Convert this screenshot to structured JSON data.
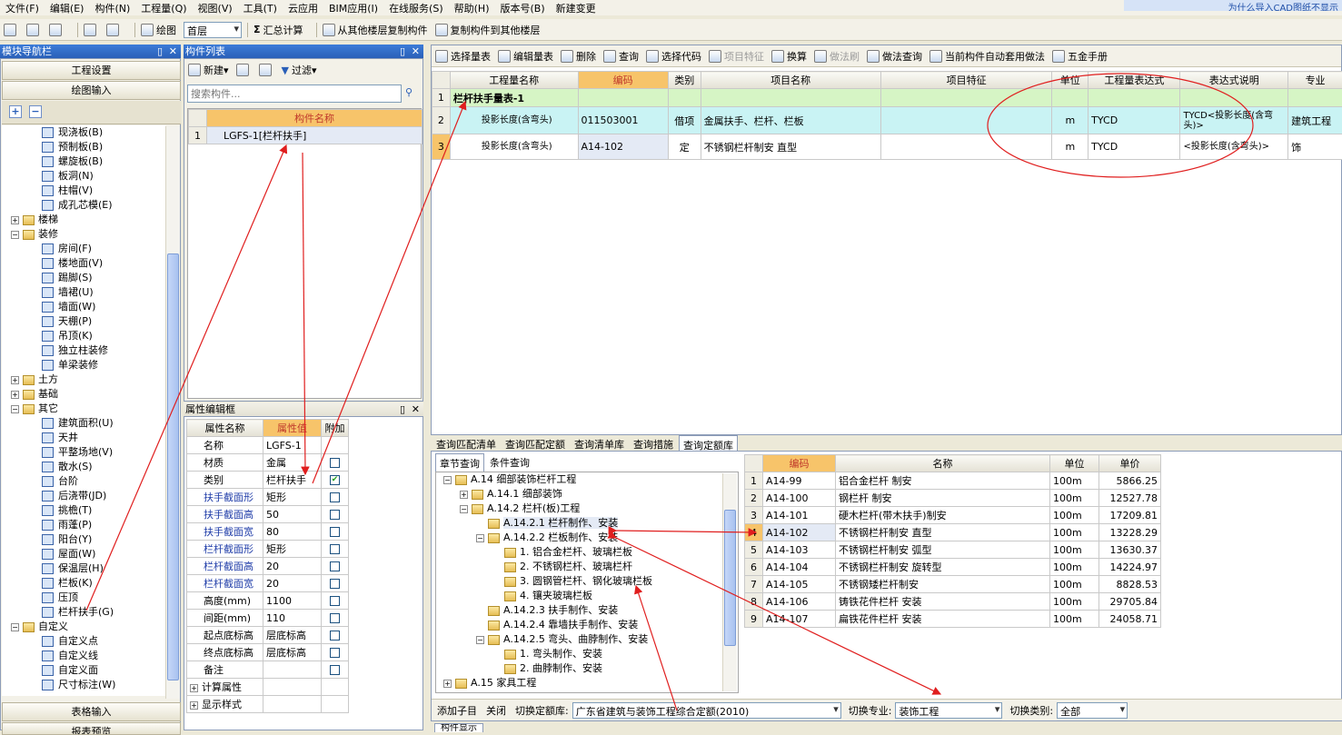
{
  "menu": [
    "文件(F)",
    "编辑(E)",
    "构件(N)",
    "工程量(Q)",
    "视图(V)",
    "工具(T)",
    "云应用",
    "BIM应用(I)",
    "在线服务(S)",
    "帮助(H)",
    "版本号(B)",
    "新建变更"
  ],
  "hint_text": "为什么导入CAD图纸不显示",
  "toolbar": {
    "draw": "绘图",
    "floor": "首层",
    "sum": "汇总计算",
    "copy_from": "从其他楼层复制构件",
    "copy_to": "复制构件到其他楼层"
  },
  "nav": {
    "title": "模块导航栏",
    "project_settings": "工程设置",
    "draw_input": "绘图输入",
    "table_input": "表格输入",
    "report": "报表预览"
  },
  "tree": [
    {
      "label": "现浇板(B)",
      "level": 2
    },
    {
      "label": "预制板(B)",
      "level": 2
    },
    {
      "label": "螺旋板(B)",
      "level": 2
    },
    {
      "label": "板洞(N)",
      "level": 2
    },
    {
      "label": "柱帽(V)",
      "level": 2
    },
    {
      "label": "成孔芯模(E)",
      "level": 2
    },
    {
      "label": "楼梯",
      "level": 0,
      "folder": true,
      "pm": "+"
    },
    {
      "label": "装修",
      "level": 0,
      "folder": true,
      "pm": "-"
    },
    {
      "label": "房间(F)",
      "level": 2
    },
    {
      "label": "楼地面(V)",
      "level": 2
    },
    {
      "label": "踢脚(S)",
      "level": 2
    },
    {
      "label": "墙裙(U)",
      "level": 2
    },
    {
      "label": "墙面(W)",
      "level": 2
    },
    {
      "label": "天棚(P)",
      "level": 2
    },
    {
      "label": "吊顶(K)",
      "level": 2
    },
    {
      "label": "独立柱装修",
      "level": 2
    },
    {
      "label": "单梁装修",
      "level": 2
    },
    {
      "label": "土方",
      "level": 0,
      "folder": true,
      "pm": "+"
    },
    {
      "label": "基础",
      "level": 0,
      "folder": true,
      "pm": "+"
    },
    {
      "label": "其它",
      "level": 0,
      "folder": true,
      "pm": "-"
    },
    {
      "label": "建筑面积(U)",
      "level": 2
    },
    {
      "label": "天井",
      "level": 2
    },
    {
      "label": "平整场地(V)",
      "level": 2
    },
    {
      "label": "散水(S)",
      "level": 2
    },
    {
      "label": "台阶",
      "level": 2
    },
    {
      "label": "后浇带(JD)",
      "level": 2
    },
    {
      "label": "挑檐(T)",
      "level": 2
    },
    {
      "label": "雨蓬(P)",
      "level": 2
    },
    {
      "label": "阳台(Y)",
      "level": 2
    },
    {
      "label": "屋面(W)",
      "level": 2
    },
    {
      "label": "保温层(H)",
      "level": 2
    },
    {
      "label": "栏板(K)",
      "level": 2
    },
    {
      "label": "压顶",
      "level": 2
    },
    {
      "label": "栏杆扶手(G)",
      "level": 2
    },
    {
      "label": "自定义",
      "level": 0,
      "folder": true,
      "pm": "-"
    },
    {
      "label": "自定义点",
      "level": 2
    },
    {
      "label": "自定义线",
      "level": 2
    },
    {
      "label": "自定义面",
      "level": 2
    },
    {
      "label": "尺寸标注(W)",
      "level": 2
    }
  ],
  "comp": {
    "title": "构件列表",
    "new": "新建",
    "filter": "过滤",
    "search_placeholder": "搜索构件...",
    "col": "构件名称",
    "rows": [
      {
        "n": "1",
        "name": "LGFS-1[栏杆扶手]"
      }
    ]
  },
  "prop": {
    "title": "属性编辑框",
    "cols": [
      "属性名称",
      "属性值",
      "附加"
    ],
    "rows": [
      {
        "name": "名称",
        "value": "LGFS-1",
        "chk": null,
        "blue": false
      },
      {
        "name": "材质",
        "value": "金属",
        "chk": false,
        "blue": false
      },
      {
        "name": "类别",
        "value": "栏杆扶手",
        "chk": true,
        "blue": false
      },
      {
        "name": "扶手截面形",
        "value": "矩形",
        "chk": false,
        "blue": true
      },
      {
        "name": "扶手截面高",
        "value": "50",
        "chk": false,
        "blue": true
      },
      {
        "name": "扶手截面宽",
        "value": "80",
        "chk": false,
        "blue": true
      },
      {
        "name": "栏杆截面形",
        "value": "矩形",
        "chk": false,
        "blue": true
      },
      {
        "name": "栏杆截面高",
        "value": "20",
        "chk": false,
        "blue": true
      },
      {
        "name": "栏杆截面宽",
        "value": "20",
        "chk": false,
        "blue": true
      },
      {
        "name": "高度(mm)",
        "value": "1100",
        "chk": false,
        "blue": false
      },
      {
        "name": "间距(mm)",
        "value": "110",
        "chk": false,
        "blue": false
      },
      {
        "name": "起点底标高",
        "value": "层底标高",
        "chk": false,
        "blue": false
      },
      {
        "name": "终点底标高",
        "value": "层底标高",
        "chk": false,
        "blue": false
      },
      {
        "name": "备注",
        "value": "",
        "chk": false,
        "blue": false
      },
      {
        "name": "计算属性",
        "value": "",
        "chk": null,
        "blue": false
      },
      {
        "name": "显示样式",
        "value": "",
        "chk": null,
        "blue": false
      }
    ]
  },
  "qtb": {
    "buttons": [
      "选择量表",
      "编辑量表",
      "删除",
      "查询",
      "选择代码",
      "项目特征",
      "换算",
      "做法刷",
      "做法查询",
      "当前构件自动套用做法",
      "五金手册"
    ],
    "cols": [
      "工程量名称",
      "编码",
      "类别",
      "项目名称",
      "项目特征",
      "单位",
      "工程量表达式",
      "表达式说明",
      "专业"
    ],
    "rows": [
      {
        "n": "1",
        "name": "栏杆扶手量表-1",
        "code": "",
        "type": "",
        "item": "",
        "feat": "",
        "unit": "",
        "expr": "",
        "desc": "",
        "major": ""
      },
      {
        "n": "2",
        "name": "投影长度(含弯头)",
        "code": "011503001",
        "type": "借项",
        "item": "金属扶手、栏杆、栏板",
        "feat": "",
        "unit": "m",
        "expr": "TYCD",
        "desc": "TYCD<投影长度(含弯头)>",
        "major": "建筑工程"
      },
      {
        "n": "3",
        "name": "投影长度(含弯头)",
        "code": "A14-102",
        "type": "定",
        "item": "不锈钢栏杆制安 直型",
        "feat": "",
        "unit": "m",
        "expr": "TYCD",
        "desc": "<投影长度(含弯头)>",
        "major": "饰"
      }
    ]
  },
  "lower": {
    "tabs": [
      "查询匹配清单",
      "查询匹配定额",
      "查询清单库",
      "查询措施",
      "查询定额库"
    ],
    "subtabs": [
      "章节查询",
      "条件查询"
    ],
    "tree": [
      {
        "label": "A.14 细部装饰栏杆工程",
        "lvl": 0,
        "pm": "-"
      },
      {
        "label": "A.14.1 细部装饰",
        "lvl": 1,
        "pm": "+"
      },
      {
        "label": "A.14.2 栏杆(板)工程",
        "lvl": 1,
        "pm": "-"
      },
      {
        "label": "A.14.2.1 栏杆制作、安装",
        "lvl": 2,
        "pm": ""
      },
      {
        "label": "A.14.2.2 栏板制作、安装",
        "lvl": 2,
        "pm": "-"
      },
      {
        "label": "1. 铝合金栏杆、玻璃栏板",
        "lvl": 3,
        "pm": ""
      },
      {
        "label": "2. 不锈钢栏杆、玻璃栏杆",
        "lvl": 3,
        "pm": ""
      },
      {
        "label": "3. 圆钢管栏杆、钢化玻璃栏板",
        "lvl": 3,
        "pm": ""
      },
      {
        "label": "4. 镶夹玻璃栏板",
        "lvl": 3,
        "pm": ""
      },
      {
        "label": "A.14.2.3 扶手制作、安装",
        "lvl": 2,
        "pm": ""
      },
      {
        "label": "A.14.2.4 靠墙扶手制作、安装",
        "lvl": 2,
        "pm": ""
      },
      {
        "label": "A.14.2.5 弯头、曲脖制作、安装",
        "lvl": 2,
        "pm": "-"
      },
      {
        "label": "1. 弯头制作、安装",
        "lvl": 3,
        "pm": ""
      },
      {
        "label": "2. 曲脖制作、安装",
        "lvl": 3,
        "pm": ""
      },
      {
        "label": "A.15 家具工程",
        "lvl": 0,
        "pm": "+"
      }
    ],
    "cols": [
      "编码",
      "名称",
      "单位",
      "单价"
    ],
    "rows": [
      {
        "n": "1",
        "code": "A14-99",
        "name": "铝合金栏杆 制安",
        "unit": "100m",
        "price": "5866.25"
      },
      {
        "n": "2",
        "code": "A14-100",
        "name": "钢栏杆 制安",
        "unit": "100m",
        "price": "12527.78"
      },
      {
        "n": "3",
        "code": "A14-101",
        "name": "硬木栏杆(带木扶手)制安",
        "unit": "100m",
        "price": "17209.81"
      },
      {
        "n": "4",
        "code": "A14-102",
        "name": "不锈钢栏杆制安 直型",
        "unit": "100m",
        "price": "13228.29"
      },
      {
        "n": "5",
        "code": "A14-103",
        "name": "不锈钢栏杆制安 弧型",
        "unit": "100m",
        "price": "13630.37"
      },
      {
        "n": "6",
        "code": "A14-104",
        "name": "不锈钢栏杆制安 旋转型",
        "unit": "100m",
        "price": "14224.97"
      },
      {
        "n": "7",
        "code": "A14-105",
        "name": "不锈钢矮栏杆制安",
        "unit": "100m",
        "price": "8828.53"
      },
      {
        "n": "8",
        "code": "A14-106",
        "name": "铸铁花件栏杆 安装",
        "unit": "100m",
        "price": "29705.84"
      },
      {
        "n": "9",
        "code": "A14-107",
        "name": "扁铁花件栏杆 安装",
        "unit": "100m",
        "price": "24058.71"
      }
    ],
    "add_child": "添加子目",
    "close": "关闭",
    "switch_lib_label": "切换定额库:",
    "switch_lib_value": "广东省建筑与装饰工程综合定额(2010)",
    "switch_major_label": "切换专业:",
    "switch_major_value": "装饰工程",
    "switch_type_label": "切换类别:",
    "switch_type_value": "全部",
    "bottom_tab": "构件显示"
  },
  "colors": {
    "accent": "#F7C46A",
    "title_blue": "#2A5FB8",
    "annotation": "#E01E1E"
  }
}
